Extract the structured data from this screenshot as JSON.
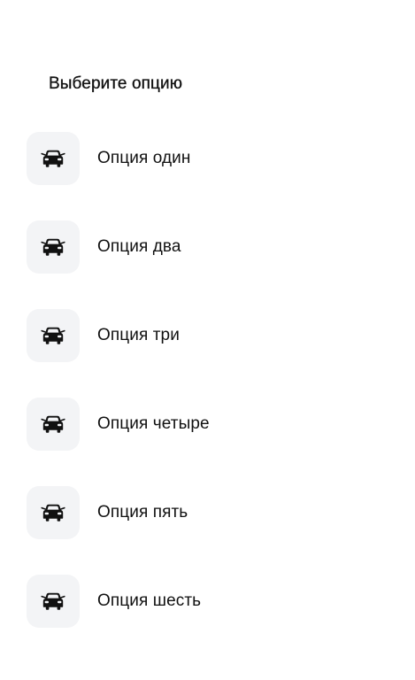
{
  "heading": "Выберите опцию",
  "options": [
    {
      "label": "Опция один",
      "icon": "car-icon"
    },
    {
      "label": "Опция два",
      "icon": "car-icon"
    },
    {
      "label": "Опция три",
      "icon": "car-icon"
    },
    {
      "label": "Опция четыре",
      "icon": "car-icon"
    },
    {
      "label": "Опция пять",
      "icon": "car-icon"
    },
    {
      "label": "Опция шесть",
      "icon": "car-icon"
    }
  ],
  "colors": {
    "background": "#ffffff",
    "tile": "#f3f4f6",
    "text": "#111111",
    "icon": "#111111"
  }
}
